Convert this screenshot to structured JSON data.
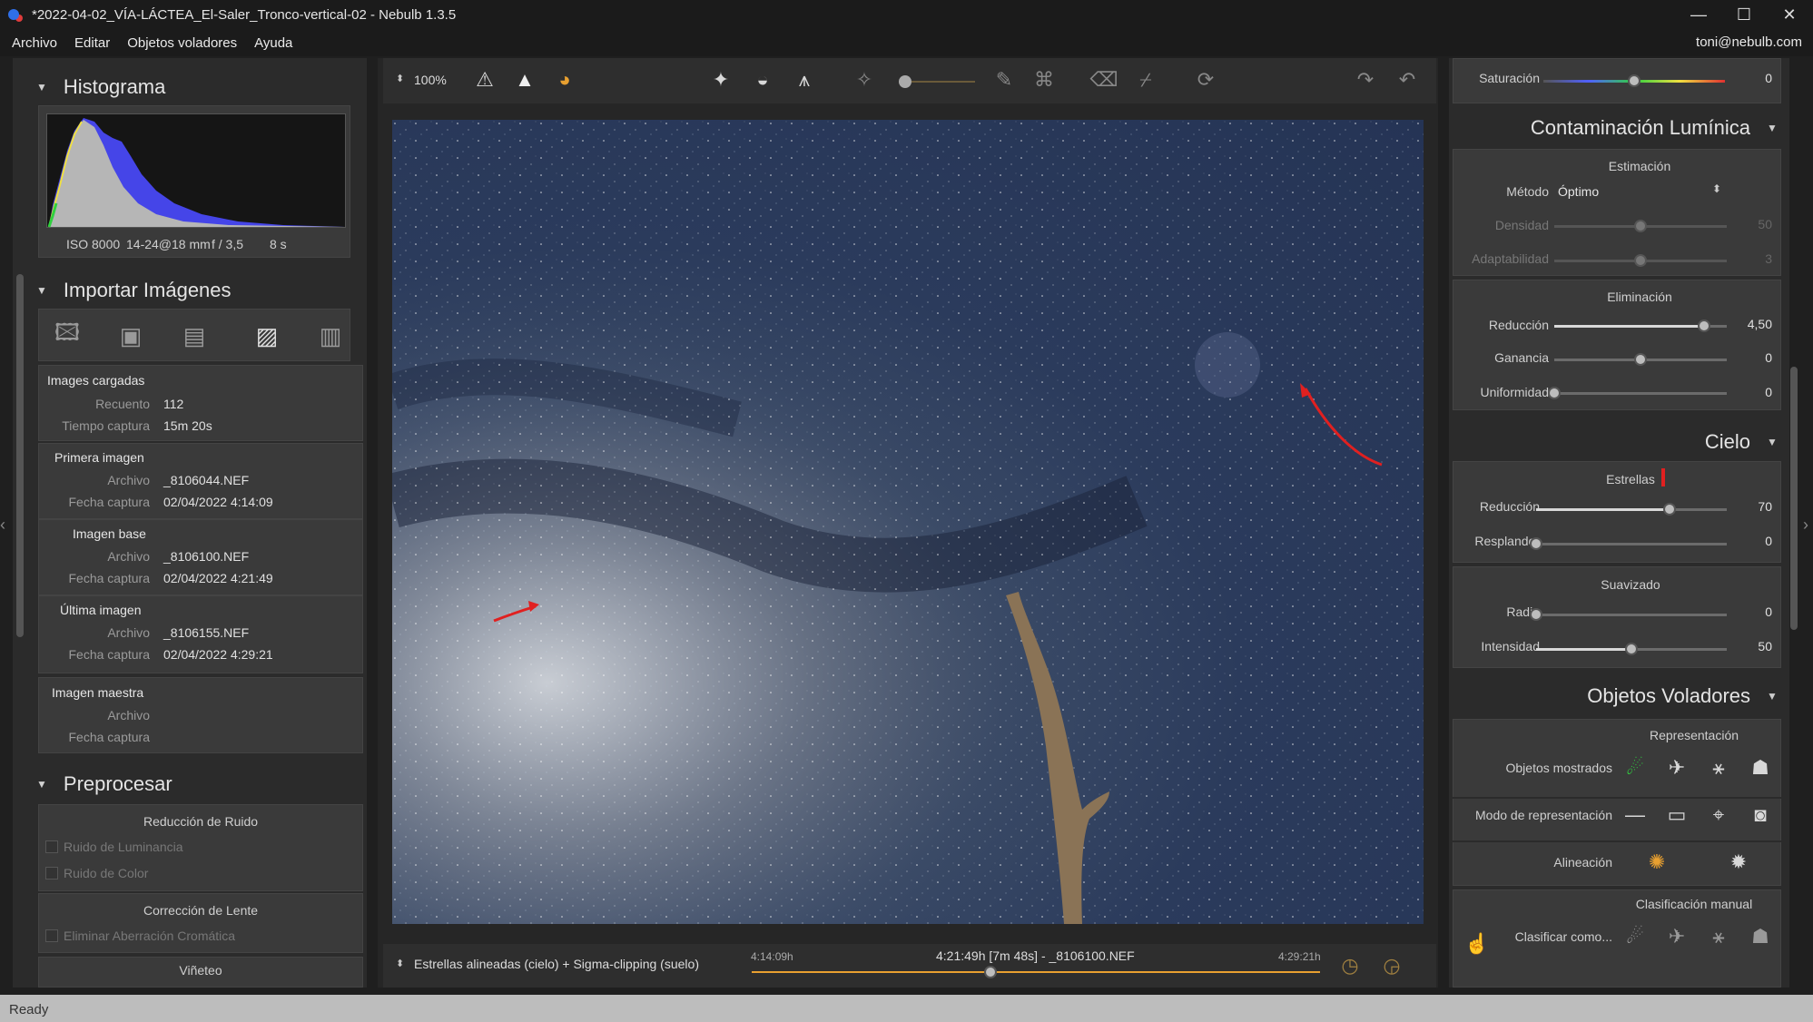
{
  "window": {
    "title": "*2022-04-02_VÍA-LÁCTEA_El-Saler_Tronco-vertical-02 - Nebulb 1.3.5",
    "minimize": "—",
    "maximize": "☐",
    "close": "✕"
  },
  "menu": {
    "items": [
      "Archivo",
      "Editar",
      "Objetos voladores",
      "Ayuda"
    ],
    "user": "toni@nebulb.com"
  },
  "toolbar": {
    "zoom": "100%",
    "icons": [
      "warning-outline-icon",
      "warning-filled-icon",
      "palette-icon",
      "stars-icon",
      "planet-icon",
      "tripod-icon",
      "wand-icon",
      "brush-icon",
      "brush-mask-icon",
      "eraser-icon",
      "broom-icon",
      "refresh-icon",
      "redo-icon",
      "undo-icon"
    ],
    "accent": "#e8a030"
  },
  "histogram": {
    "title": "Histograma",
    "iso": "ISO 8000",
    "lens": "14-24@18 mm",
    "aperture": "f / 3,5",
    "shutter": "8 s"
  },
  "import": {
    "title": "Importar Imágenes",
    "loaded": {
      "head": "Images cargadas",
      "count_label": "Recuento",
      "count": "112",
      "time_label": "Tiempo captura",
      "time": "15m 20s"
    },
    "first": {
      "head": "Primera imagen",
      "file_label": "Archivo",
      "file": "_8106044.NEF",
      "date_label": "Fecha captura",
      "date": "02/04/2022 4:14:09"
    },
    "base": {
      "head": "Imagen base",
      "file_label": "Archivo",
      "file": "_8106100.NEF",
      "date_label": "Fecha captura",
      "date": "02/04/2022 4:21:49"
    },
    "last": {
      "head": "Última imagen",
      "file_label": "Archivo",
      "file": "_8106155.NEF",
      "date_label": "Fecha captura",
      "date": "02/04/2022 4:29:21"
    },
    "master": {
      "head": "Imagen maestra",
      "file_label": "Archivo",
      "date_label": "Fecha captura"
    }
  },
  "preprocess": {
    "title": "Preprocesar",
    "noise_head": "Reducción de Ruido",
    "lum": "Ruido de Luminancia",
    "color": "Ruido de Color",
    "lens_head": "Corrección de Lente",
    "chrom": "Eliminar Aberración Cromática",
    "vignette": "Viñeteo"
  },
  "bottom": {
    "mode": "Estrellas alineadas (cielo) + Sigma-clipping (suelo)",
    "start": "4:14:09h",
    "current": "4:21:49h [7m 48s] - _8106100.NEF",
    "end": "4:29:21h",
    "position": 0.42
  },
  "right": {
    "saturation": {
      "label": "Saturación",
      "value": "0",
      "position": 0.5
    },
    "lp": {
      "title": "Contaminación Lumínica",
      "est_head": "Estimación",
      "method_label": "Método",
      "method": "Óptimo",
      "density_label": "Densidad",
      "density": "50",
      "density_pos": 0.5,
      "adapt_label": "Adaptabilidad",
      "adapt": "3",
      "adapt_pos": 0.5,
      "elim_head": "Eliminación",
      "red_label": "Reducción",
      "red": "4,50",
      "red_pos": 0.87,
      "gain_label": "Ganancia",
      "gain": "0",
      "gain_pos": 0.5,
      "unif_label": "Uniformidad",
      "unif": "0",
      "unif_pos": 0.0
    },
    "sky": {
      "title": "Cielo",
      "stars_head": "Estrellas",
      "red_label": "Reducción",
      "red": "70",
      "red_pos": 0.7,
      "glow_label": "Resplandor",
      "glow": "0",
      "glow_pos": 0.0,
      "smooth_head": "Suavizado",
      "radius_label": "Radio",
      "radius": "0",
      "radius_pos": 0.0,
      "intensity_label": "Intensidad",
      "intensity": "50",
      "intensity_pos": 0.5
    },
    "flying": {
      "title": "Objetos Voladores",
      "rep_head": "Representación",
      "shown_label": "Objetos mostrados",
      "mode_label": "Modo de representación",
      "align_label": "Alineación",
      "manual_head": "Clasificación manual",
      "classify_label": "Clasificar como..."
    }
  },
  "status": "Ready"
}
